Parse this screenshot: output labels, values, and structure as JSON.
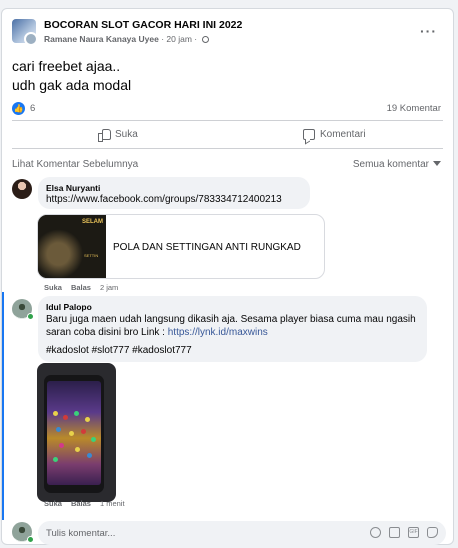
{
  "post": {
    "group_name": "BOCORAN SLOT GACOR HARI INI 2022",
    "author": "Ramane Naura Kanaya Uyee",
    "time": "20 jam",
    "separator": "·",
    "more_icon": "ellipsis-icon",
    "text_lines": [
      "cari freebet ajaa..",
      "udh gak ada modal"
    ],
    "like_count": "6",
    "comment_count": "19 Komentar",
    "like_label": "Suka",
    "comment_label": "Komentari"
  },
  "comments_section": {
    "view_previous": "Lihat Komentar Sebelumnya",
    "filter": "Semua komentar"
  },
  "comments": [
    {
      "name": "Elsa Nuryanti",
      "text": "https://www.facebook.com/groups/783334712400213",
      "link_card": {
        "thumb_text": "SELAM",
        "thumb_sub": "SETTIN",
        "title": "POLA DAN SETTINGAN ANTI RUNGKAD"
      },
      "like": "Suka",
      "reply": "Balas",
      "time": "2 jam"
    },
    {
      "name": "Idul Palopo",
      "line1": "Baru juga maen udah langsung dikasih aja. Sesama player biasa cuma mau ngasih",
      "line2_prefix": "saran coba disini bro Link : ",
      "line2_link": "https://lynk.id/maxwins",
      "hashtags": "#kadoslot #slot777 #kadoslot777",
      "like": "Suka",
      "reply": "Balas",
      "time": "1 menit"
    }
  ],
  "composer": {
    "placeholder": "Tulis komentar...",
    "gif_label": "GIF"
  },
  "colors": {
    "accent": "#1877f2",
    "link": "#385898",
    "online": "#31a24c",
    "secondary_text": "#65676b"
  }
}
